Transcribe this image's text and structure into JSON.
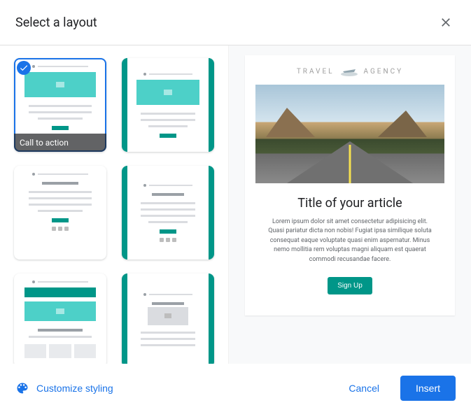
{
  "header": {
    "title": "Select a layout"
  },
  "templates": [
    {
      "label": "Call to action",
      "selected": true
    },
    {
      "label": "",
      "selected": false
    },
    {
      "label": "",
      "selected": false
    },
    {
      "label": "",
      "selected": false
    },
    {
      "label": "",
      "selected": false
    },
    {
      "label": "",
      "selected": false
    }
  ],
  "preview": {
    "logo_left": "TRAVEL",
    "logo_right": "AGENCY",
    "article_title": "Title of your article",
    "article_body": "Lorem ipsum dolor sit amet consectetur adipisicing elit. Quasi pariatur dicta non nobis! Fugiat ipsa similique soluta consequat eaque voluptate quasi enim aspernatur. Minus nemo mollitia rem voluptas magni aliquam est quaerat commodi recusandae facere.",
    "signup_label": "Sign Up"
  },
  "footer": {
    "customize_label": "Customize styling",
    "cancel_label": "Cancel",
    "insert_label": "Insert"
  }
}
